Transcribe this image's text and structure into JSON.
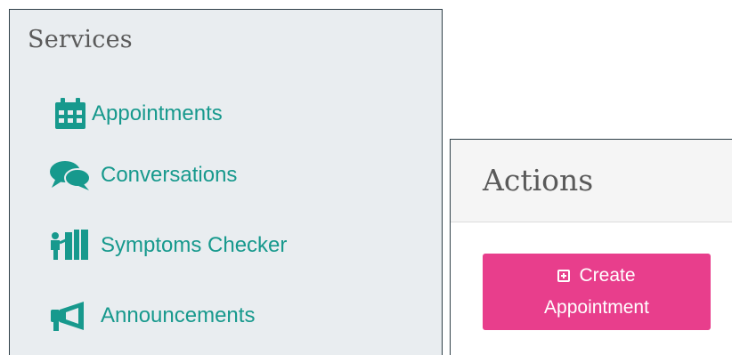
{
  "services": {
    "title": "Services",
    "items": [
      {
        "label": "Appointments",
        "icon": "calendar-icon"
      },
      {
        "label": "Conversations",
        "icon": "comments-icon"
      },
      {
        "label": "Symptoms Checker",
        "icon": "person-chart-icon"
      },
      {
        "label": "Announcements",
        "icon": "megaphone-icon"
      }
    ]
  },
  "actions": {
    "title": "Actions",
    "create_button": {
      "line1": "Create",
      "line2": "Appointment",
      "icon": "plus-square-icon"
    }
  },
  "colors": {
    "accent": "#17998d",
    "button": "#e83e8c",
    "panel_bg": "#e9edf0"
  }
}
